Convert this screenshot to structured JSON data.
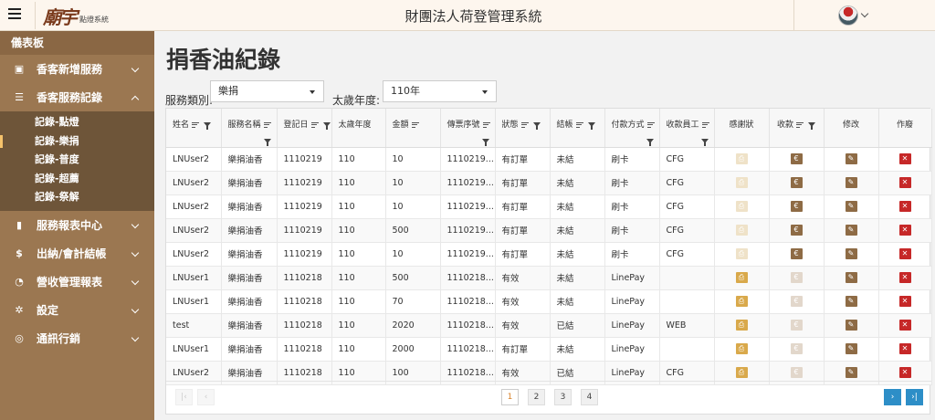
{
  "header": {
    "title": "財團法人荷登管理系統",
    "logo_mark": "廟宇",
    "logo_text": "點燈系統"
  },
  "sidebar": {
    "dashboard": "儀表板",
    "items": [
      {
        "label": "香客新增服務",
        "icon": "id-card-icon",
        "expanded": false
      },
      {
        "label": "香客服務記錄",
        "icon": "list-icon",
        "expanded": true
      },
      {
        "label": "服務報表中心",
        "icon": "bar-chart-icon",
        "expanded": false
      },
      {
        "label": "出納/會計結帳",
        "icon": "dollar-icon",
        "expanded": false
      },
      {
        "label": "營收管理報表",
        "icon": "pie-chart-icon",
        "expanded": false
      },
      {
        "label": "設定",
        "icon": "gear-icon",
        "expanded": false
      },
      {
        "label": "通訊行銷",
        "icon": "broadcast-icon",
        "expanded": false
      }
    ],
    "subitems": [
      {
        "label": "記錄-點燈",
        "active": false
      },
      {
        "label": "記錄-樂捐",
        "active": true
      },
      {
        "label": "記錄-普度",
        "active": false
      },
      {
        "label": "記錄-超薦",
        "active": false
      },
      {
        "label": "記錄-祭解",
        "active": false
      }
    ]
  },
  "page": {
    "title": "捐香油紀錄",
    "filter_category_label": "服務類別:",
    "filter_category_value": "樂捐",
    "filter_year_label": "太歲年度:",
    "filter_year_value": "110年"
  },
  "table": {
    "headers": [
      "姓名",
      "服務名稱",
      "登記日",
      "太歲年度",
      "金額",
      "傳票序號",
      "狀態",
      "結帳",
      "付款方式",
      "收款員工",
      "感謝狀",
      "收款",
      "修改",
      "作廢"
    ],
    "rows": [
      [
        "LNUser2",
        "樂捐油香",
        "1110219",
        "110",
        "10",
        "1110219...",
        "有訂單",
        "未結",
        "刷卡",
        "CFG"
      ],
      [
        "LNUser2",
        "樂捐油香",
        "1110219",
        "110",
        "10",
        "1110219...",
        "有訂單",
        "未結",
        "刷卡",
        "CFG"
      ],
      [
        "LNUser2",
        "樂捐油香",
        "1110219",
        "110",
        "10",
        "1110219...",
        "有訂單",
        "未結",
        "刷卡",
        "CFG"
      ],
      [
        "LNUser2",
        "樂捐油香",
        "1110219",
        "110",
        "500",
        "1110219...",
        "有訂單",
        "未結",
        "刷卡",
        "CFG"
      ],
      [
        "LNUser2",
        "樂捐油香",
        "1110219",
        "110",
        "10",
        "1110219...",
        "有訂單",
        "未結",
        "刷卡",
        "CFG"
      ],
      [
        "LNUser1",
        "樂捐油香",
        "1110218",
        "110",
        "500",
        "1110218...",
        "有效",
        "未結",
        "LinePay",
        ""
      ],
      [
        "LNUser1",
        "樂捐油香",
        "1110218",
        "110",
        "70",
        "1110218...",
        "有效",
        "未結",
        "LinePay",
        ""
      ],
      [
        "test",
        "樂捐油香",
        "1110218",
        "110",
        "2020",
        "1110218...",
        "有效",
        "已結",
        "LinePay",
        "WEB"
      ],
      [
        "LNUser1",
        "樂捐油香",
        "1110218",
        "110",
        "2000",
        "1110218...",
        "有訂單",
        "未結",
        "LinePay",
        ""
      ],
      [
        "LNUser2",
        "樂捐油香",
        "1110218",
        "110",
        "100",
        "1110218...",
        "有效",
        "已結",
        "LinePay",
        "CFG"
      ]
    ],
    "print_enabled": [
      false,
      false,
      false,
      false,
      false,
      true,
      true,
      true,
      true,
      true
    ],
    "receive_enabled": [
      true,
      true,
      true,
      true,
      true,
      false,
      false,
      false,
      false,
      false
    ]
  },
  "pager": {
    "pages": [
      "1",
      "2",
      "3",
      "4"
    ],
    "current": "1",
    "first": "|‹",
    "prev": "‹",
    "next": "›",
    "last": "›|"
  },
  "colors": {
    "sidebar": "#9b7751",
    "sidebar_sub": "#6e5539",
    "accent_gold": "#d9a94b",
    "delete_red": "#c62828",
    "pager_blue": "#2d8ec7"
  }
}
